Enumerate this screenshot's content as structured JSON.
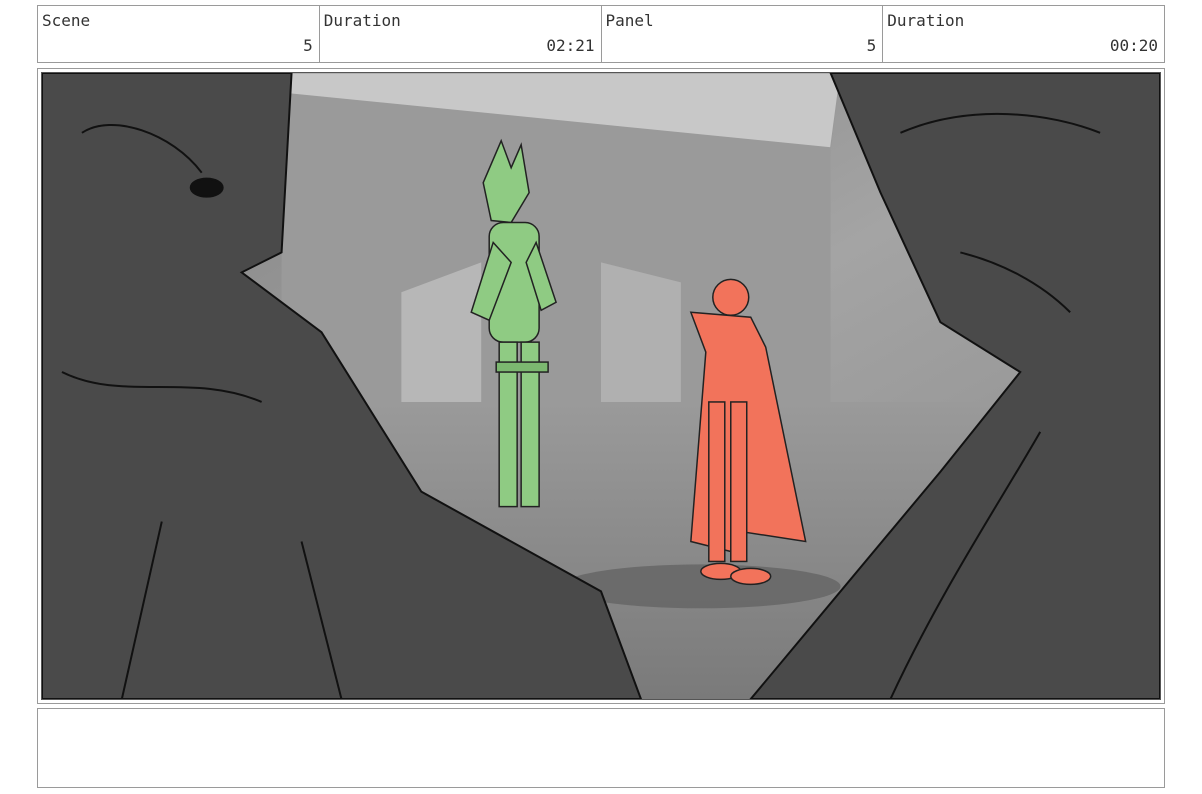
{
  "header": {
    "scene_label": "Scene",
    "scene_value": "5",
    "scene_duration_label": "Duration",
    "scene_duration_value": "02:21",
    "panel_label": "Panel",
    "panel_value": "5",
    "panel_duration_label": "Duration",
    "panel_duration_value": "00:20"
  },
  "notes": {
    "text": ""
  },
  "colors": {
    "foreground_figure": "#4a4a4a",
    "green_character": "#8fcb83",
    "red_character": "#f2735b",
    "background_gray": "#9e9e9e"
  }
}
